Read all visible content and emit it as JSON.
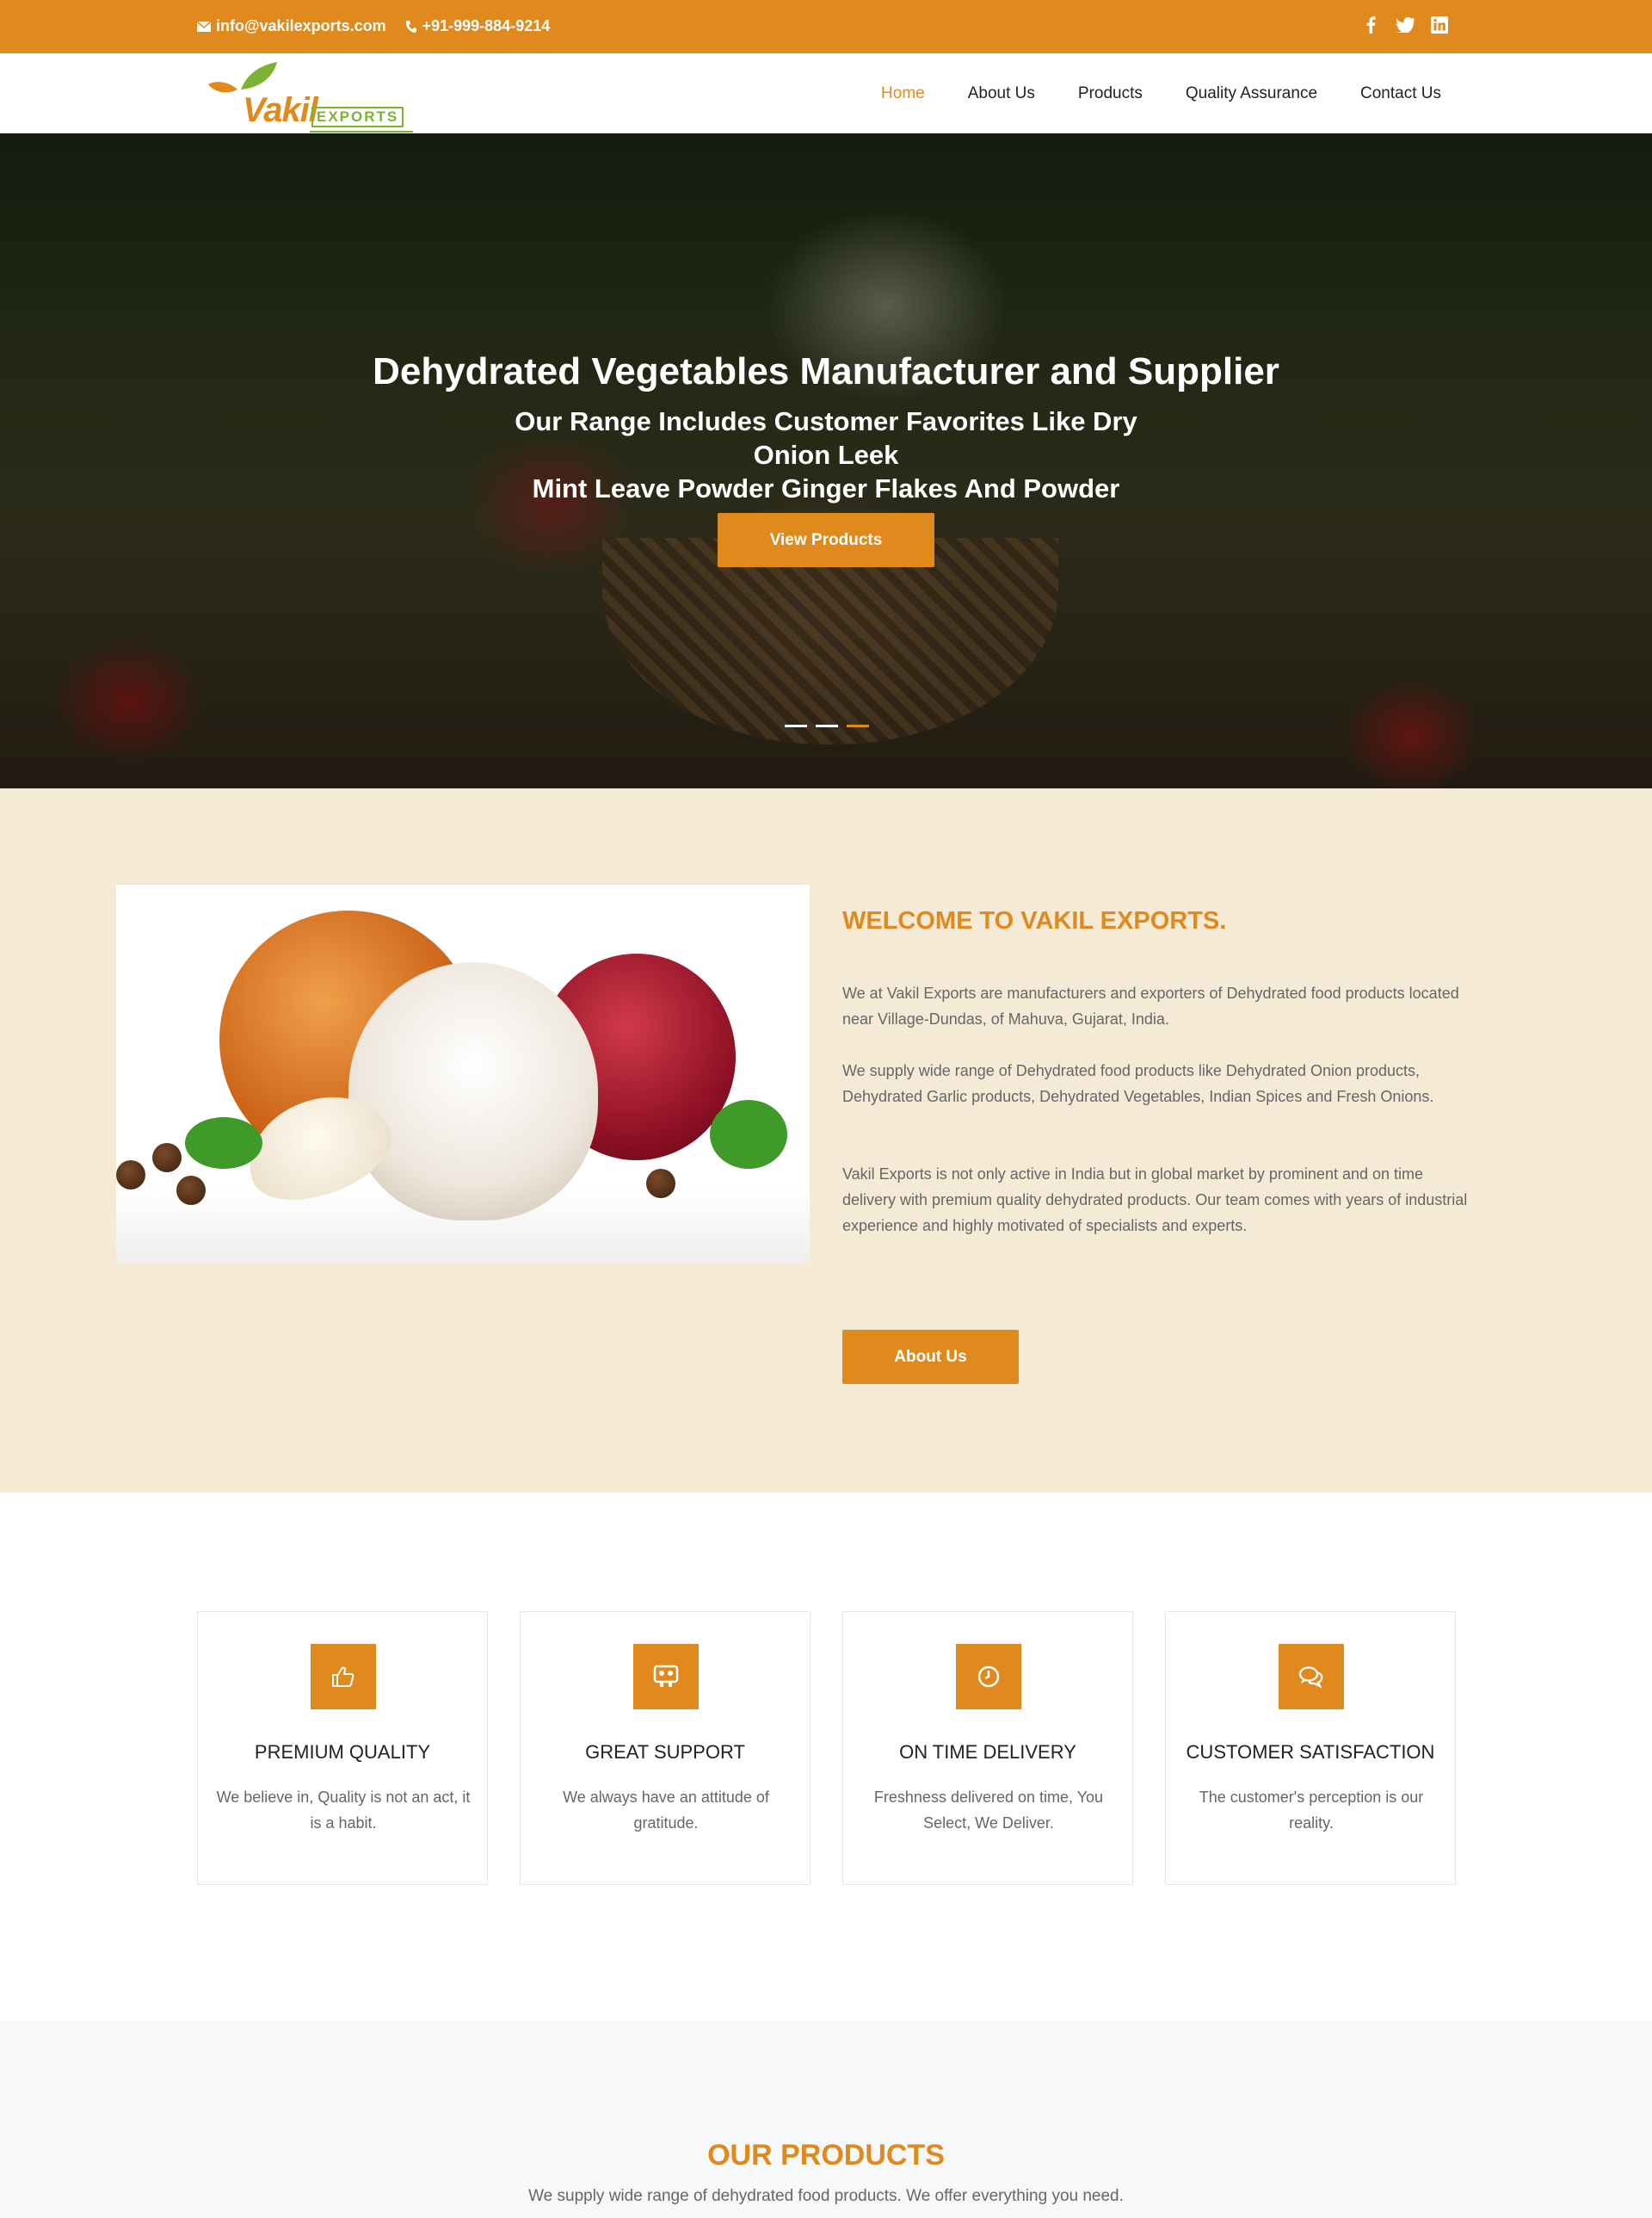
{
  "topbar": {
    "email": "info@vakilexports.com",
    "phone": "+91-999-884-9214",
    "social": [
      "facebook-icon",
      "twitter-icon",
      "linkedin-icon"
    ]
  },
  "logo": {
    "main": "Vakil",
    "sub": "EXPORTS"
  },
  "nav": [
    "Home",
    "About Us",
    "Products",
    "Quality Assurance",
    "Contact Us"
  ],
  "hero": {
    "title": "Dehydrated Vegetables Manufacturer and Supplier",
    "subtitle_line1": "Our Range Includes Customer Favorites Like Dry Onion Leek",
    "subtitle_line2": "Mint Leave Powder Ginger Flakes And Powder",
    "button": "View Products",
    "active_slide": 3,
    "slide_count": 3
  },
  "welcome": {
    "heading": "WELCOME TO VAKIL EXPORTS.",
    "para1": "We at Vakil Exports are manufacturers and exporters of Dehydrated food products located near Village-Dundas, of Mahuva, Gujarat, India.",
    "para2": "We supply wide range of Dehydrated food products like Dehydrated Onion products, Dehydrated Garlic products, Dehydrated Vegetables, Indian Spices and Fresh Onions.",
    "para3": "Vakil Exports is not only active in India but in global market by prominent and on time delivery with premium quality dehydrated products. Our team comes with years of industrial experience and highly motivated of specialists and experts.",
    "button": "About Us"
  },
  "features": [
    {
      "icon": "thumbs-up-icon",
      "title": "PREMIUM QUALITY",
      "desc": "We believe in, Quality is not an act, it is a habit."
    },
    {
      "icon": "support-icon",
      "title": "GREAT SUPPORT",
      "desc": "We always have an attitude of gratitude."
    },
    {
      "icon": "clock-icon",
      "title": "ON TIME DELIVERY",
      "desc": "Freshness delivered on time, You Select, We Deliver."
    },
    {
      "icon": "chat-icon",
      "title": "CUSTOMER SATISFACTION",
      "desc": "The customer's perception is our reality."
    }
  ],
  "products": {
    "heading": "OUR PRODUCTS",
    "subheading": "We supply wide range of dehydrated food products. We offer everything you need."
  },
  "colors": {
    "accent": "#e0891d",
    "brand_green": "#7cb334",
    "welcome_bg": "#f4ead6"
  }
}
